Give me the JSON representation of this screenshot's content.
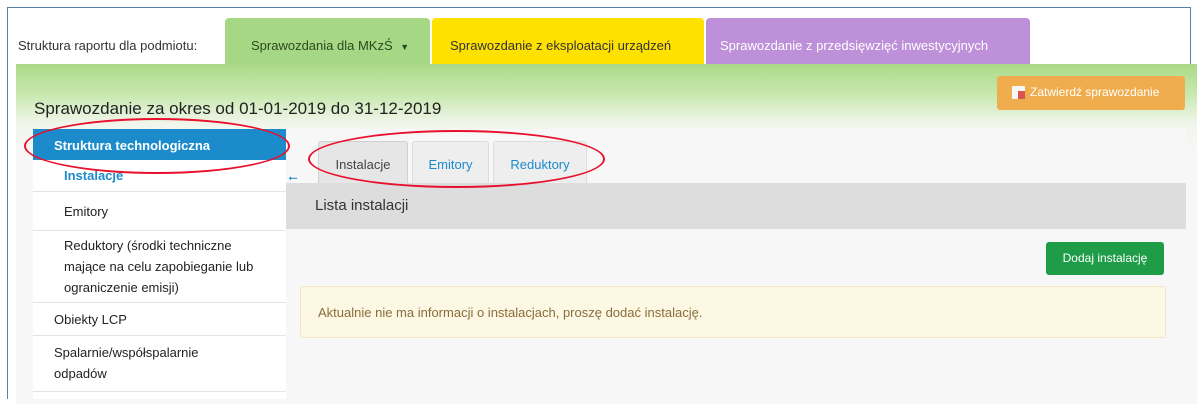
{
  "header": {
    "structure_label": "Struktura raportu dla podmiotu:",
    "tabs": [
      {
        "label": "Sprawozdania dla MKzŚ",
        "caret": "▼",
        "color": "#a6d785"
      },
      {
        "label": "Sprawozdanie z eksploatacji urządzeń",
        "color": "#ffe100"
      },
      {
        "label": "Sprawozdanie z przedsięwzięć inwestycyjnych",
        "color": "#bd90d9"
      }
    ]
  },
  "panel": {
    "period_title": "Sprawozdanie za okres od 01-01-2019 do 31-12-2019",
    "approve_label": "Zatwierdź sprawozdanie",
    "approve_icon": "document-icon"
  },
  "sidebar": {
    "header": "Struktura technologiczna",
    "items": [
      {
        "label": "Instalacje",
        "active": true
      },
      {
        "label": "Emitory"
      },
      {
        "label": "Reduktory (środki techniczne mające na celu zapobieganie lub ograniczenie emisji)"
      },
      {
        "label": "Obiekty LCP"
      },
      {
        "label": "Spalarnie/współspalarnie odpadów"
      }
    ],
    "collapse_icon": "arrow-left-icon"
  },
  "main": {
    "tabs": [
      {
        "label": "Instalacje",
        "active": true
      },
      {
        "label": "Emitory"
      },
      {
        "label": "Reduktory"
      }
    ],
    "list_title": "Lista instalacji",
    "add_button": "Dodaj instalację",
    "empty_message": "Aktualnie nie ma informacji o instalacjach, proszę dodać instalację."
  },
  "colors": {
    "accent_blue": "#1c8bcc",
    "success_green": "#1e9c48",
    "warning_orange": "#f0ad4e",
    "annotation_red": "#e8102c"
  }
}
